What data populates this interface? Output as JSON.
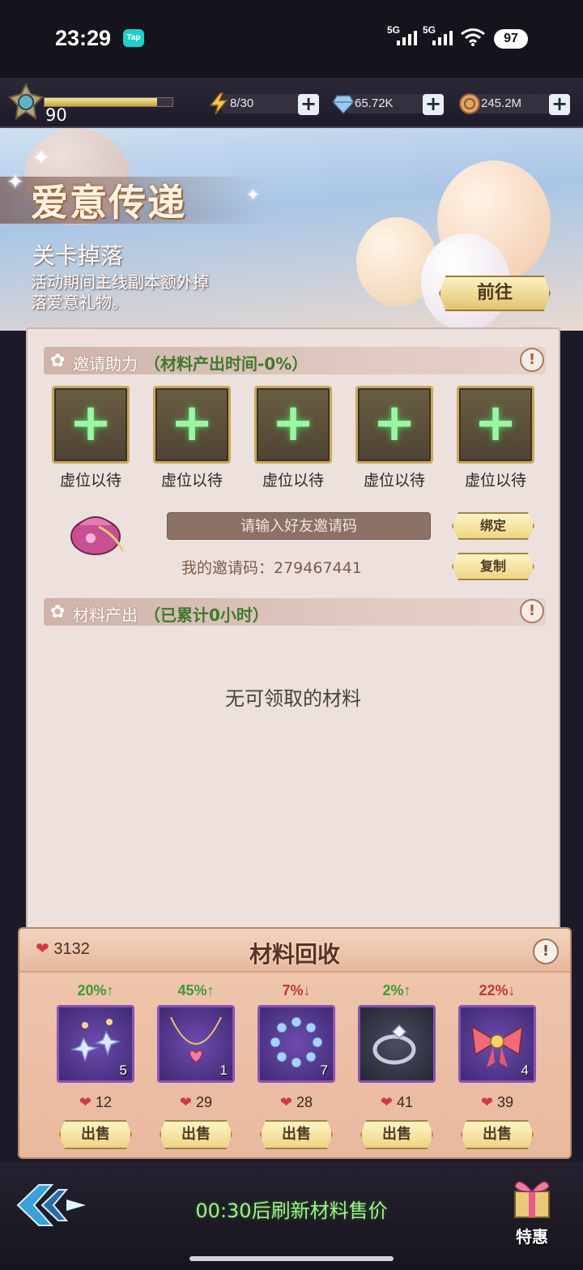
{
  "status_bar": {
    "time": "23:29",
    "app_badge": "Tap",
    "signal1": "5G",
    "signal2": "5G",
    "battery": "97"
  },
  "resources": {
    "level": "90",
    "xp_fraction": 0.88,
    "stamina": "8/30",
    "diamonds": "65.72K",
    "gold": "245.2M"
  },
  "banner": {
    "title": "爱意传递",
    "subtitle": "关卡掉落",
    "description": "活动期间主线副本额外掉落爱意礼物。",
    "goto_button": "前往"
  },
  "invite": {
    "header_label": "邀请助力",
    "header_note": "（材料产出时间-0%）",
    "slots": [
      {
        "label": "虚位以待"
      },
      {
        "label": "虚位以待"
      },
      {
        "label": "虚位以待"
      },
      {
        "label": "虚位以待"
      },
      {
        "label": "虚位以待"
      }
    ],
    "code_placeholder": "请输入好友邀请码",
    "bind_button": "绑定",
    "copy_button": "复制",
    "my_code": "我的邀请码：279467441"
  },
  "output": {
    "header_label": "材料产出",
    "header_note": "（已累计0小时）",
    "empty_message": "无可领取的材料"
  },
  "recycle": {
    "heart_total": "3132",
    "title": "材料回收",
    "items": [
      {
        "name": "earrings",
        "trend": "20%↑",
        "trend_dir": "up",
        "count": "5",
        "price": "12",
        "sell": "出售"
      },
      {
        "name": "necklace",
        "trend": "45%↑",
        "trend_dir": "up",
        "count": "1",
        "price": "29",
        "sell": "出售"
      },
      {
        "name": "bracelet",
        "trend": "7%↓",
        "trend_dir": "down",
        "count": "7",
        "price": "28",
        "sell": "出售"
      },
      {
        "name": "ring",
        "trend": "2%↑",
        "trend_dir": "up",
        "count": "",
        "price": "41",
        "sell": "出售"
      },
      {
        "name": "bow",
        "trend": "22%↓",
        "trend_dir": "down",
        "count": "4",
        "price": "39",
        "sell": "出售"
      }
    ]
  },
  "bottom": {
    "refresh_text": "00:30后刷新材料售价",
    "special_label": "特惠"
  },
  "icons": {
    "stamina": "lightning-icon",
    "diamond": "diamond-icon",
    "gold": "coin-icon",
    "heart": "heart-icon",
    "info": "info-icon",
    "back": "back-arrow-icon",
    "gift": "gift-box-icon"
  }
}
